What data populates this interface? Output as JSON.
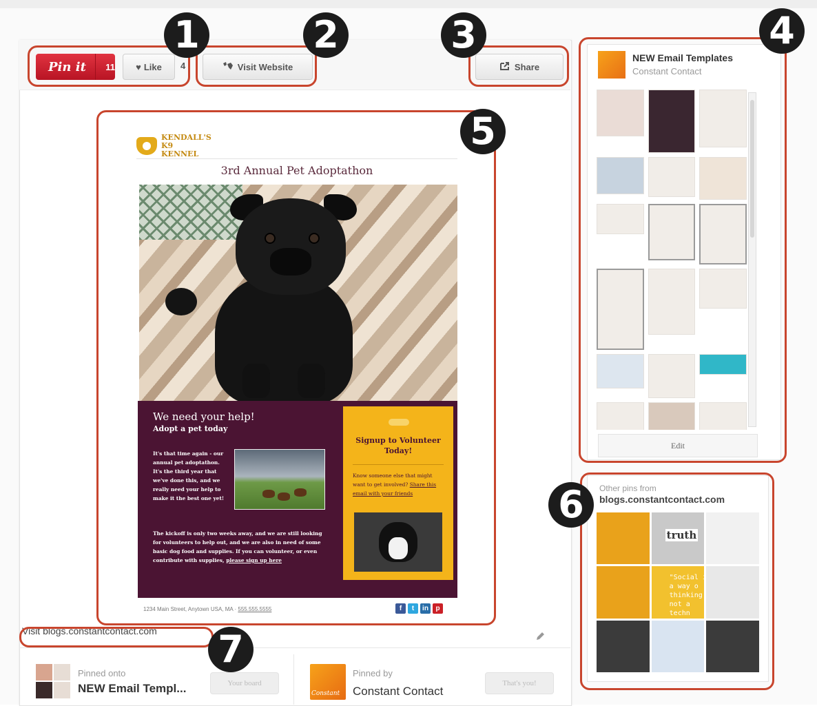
{
  "callouts": [
    "1",
    "2",
    "3",
    "4",
    "5",
    "6",
    "7"
  ],
  "toolbar": {
    "pin_label": "Pin it",
    "pin_count": "11",
    "like_label": "Like",
    "like_count": "4",
    "visit_label": "Visit Website",
    "share_label": "Share"
  },
  "email": {
    "brand_line1": "KENDALL'S",
    "brand_line2": "K9 KENNEL",
    "title": "3rd Annual Pet Adoptathon",
    "headline": "We need your help!",
    "subhead": "Adopt a pet today",
    "body1": "It's that time again - our annual pet adoptathon. It's the third year that we've done this, and we really need your help to make it the best one yet!",
    "body2_text": "The kickoff is only two weeks away, and we are still looking for volunteers to help out, and we are also in need of some basic dog food and supplies. If you can volunteer, or even contribute with supplies,",
    "body2_link": "please sign up here",
    "volunteer_title": "Signup to Volunteer Today!",
    "volunteer_text": "Know someone else that might want to get involved?",
    "volunteer_link": "Share this email with your friends",
    "footer_address": "1234 Main Street, Anytown USA, MA",
    "footer_phone": "555.555.5555",
    "social": [
      "f",
      "t",
      "in",
      "p"
    ]
  },
  "board": {
    "title": "NEW Email Templates",
    "owner": "Constant Contact",
    "edit_label": "Edit"
  },
  "other_pins": {
    "label": "Other pins from",
    "source": "blogs.constantcontact.com",
    "tile_word": "truth",
    "tile_quote": "\"Social i\na way o\nthinking\nnot a\ntechn"
  },
  "footer": {
    "visit_source": "Visit blogs.constantcontact.com",
    "pinned_onto_label": "Pinned onto",
    "pinned_onto_board": "NEW Email Templ...",
    "your_board_label": "Your board",
    "pinned_by_label": "Pinned by",
    "pinned_by_name": "Constant Contact",
    "thats_you_label": "That's you!",
    "cc_logo_text": "Constant"
  },
  "colors": {
    "pin_red": "#cb2027",
    "highlight": "#c8452d",
    "email_purple": "#4b1433",
    "email_gold": "#f4b41a"
  }
}
